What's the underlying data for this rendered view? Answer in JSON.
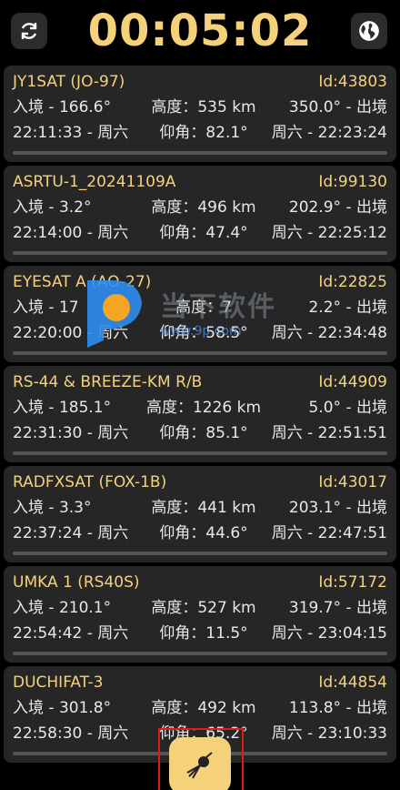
{
  "header": {
    "timer": "00:05:02",
    "refresh_icon": "refresh-icon",
    "globe_icon": "globe-icon"
  },
  "satellites": [
    {
      "name": "JY1SAT (JO-97)",
      "id": "Id:43803",
      "in": "入境 - 166.6°",
      "alt": "高度：535 km",
      "out": "350.0° - 出境",
      "start": "22:11:33 - 周六",
      "elev": "仰角：82.1°",
      "end": "周六 - 22:23:24"
    },
    {
      "name": "ASRTU-1_20241109A",
      "id": "Id:99130",
      "in": "入境 - 3.2°",
      "alt": "高度：496 km",
      "out": "202.9° - 出境",
      "start": "22:14:00 - 周六",
      "elev": "仰角：47.4°",
      "end": "周六 - 22:25:12"
    },
    {
      "name": "EYESAT A (AO-27)",
      "id": "Id:22825",
      "in": "入境 - 17",
      "alt": "高度：7",
      "out": "2.2° - 出境",
      "start": "22:20:00 - 周六",
      "elev": "仰角：58.5°",
      "end": "周六 - 22:34:48"
    },
    {
      "name": "RS-44 & BREEZE-KM R/B",
      "id": "Id:44909",
      "in": "入境 - 185.1°",
      "alt": "高度：1226 km",
      "out": "5.0° - 出境",
      "start": "22:31:30 - 周六",
      "elev": "仰角：85.1°",
      "end": "周六 - 22:51:51"
    },
    {
      "name": "RADFXSAT (FOX-1B)",
      "id": "Id:43017",
      "in": "入境 - 3.3°",
      "alt": "高度：441 km",
      "out": "203.1° - 出境",
      "start": "22:37:24 - 周六",
      "elev": "仰角：44.6°",
      "end": "周六 - 22:47:51"
    },
    {
      "name": "UMKA 1 (RS40S)",
      "id": "Id:57172",
      "in": "入境 - 210.1°",
      "alt": "高度：527 km",
      "out": "319.7° - 出境",
      "start": "22:54:42 - 周六",
      "elev": "仰角：11.5°",
      "end": "周六 - 23:04:15"
    },
    {
      "name": "DUCHIFAT-3",
      "id": "Id:44854",
      "in": "入境 - 301.8°",
      "alt": "高度：492 km",
      "out": "113.8° - 出境",
      "start": "22:58:30 - 周六",
      "elev": "仰角：65.2°",
      "end": "周六 - 23:10:33"
    }
  ],
  "fab": {
    "icon": "satellite-icon"
  },
  "watermark": {
    "text": "当下软件",
    "url": "www.9p.com"
  },
  "colors": {
    "accent": "#f5d27a",
    "card": "#262626",
    "background": "#000000"
  }
}
